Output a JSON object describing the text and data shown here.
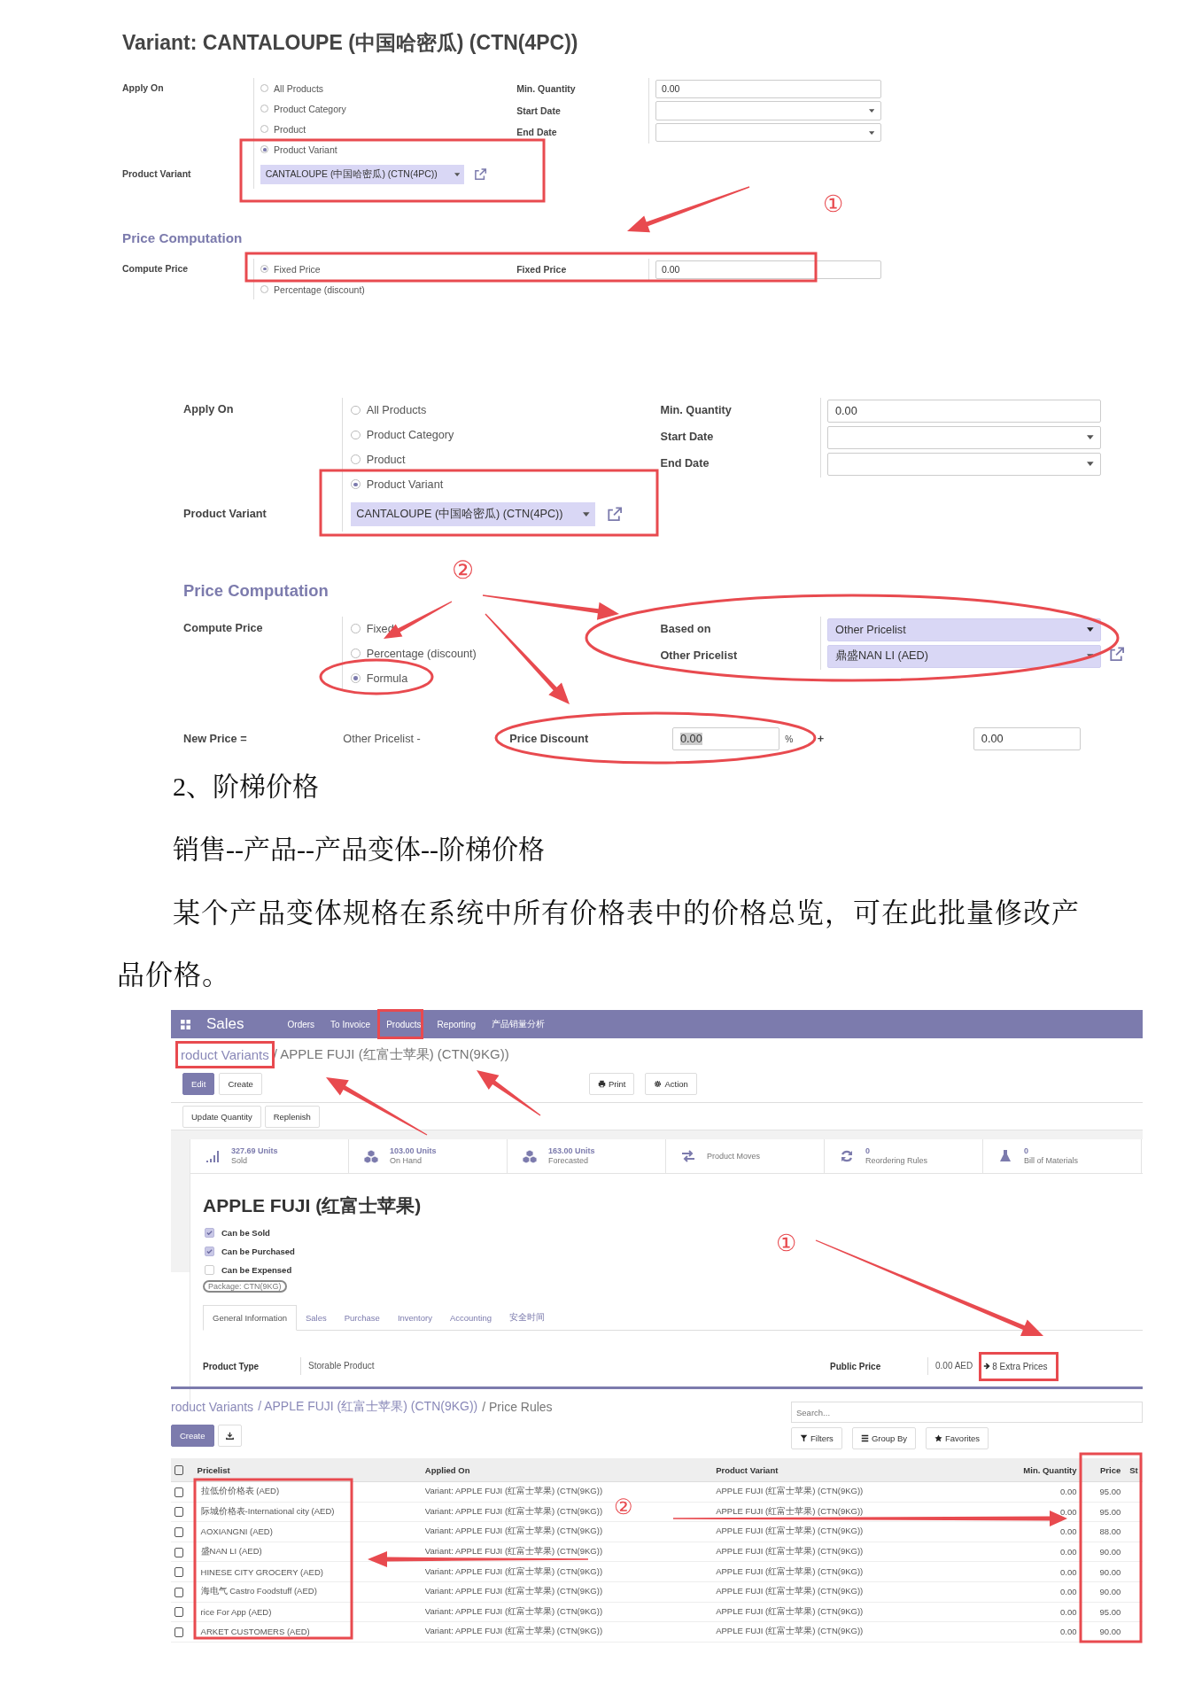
{
  "form1": {
    "title": "Variant: CANTALOUPE (中国哈密瓜) (CTN(4PC))",
    "apply_on_label": "Apply On",
    "apply_on_options": [
      {
        "label": "All Products",
        "selected": false
      },
      {
        "label": "Product Category",
        "selected": false
      },
      {
        "label": "Product",
        "selected": false
      },
      {
        "label": "Product Variant",
        "selected": true
      }
    ],
    "product_variant_label": "Product Variant",
    "product_variant_value": "CANTALOUPE (中国哈密瓜) (CTN(4PC))",
    "min_quantity_label": "Min. Quantity",
    "min_quantity_value": "0.00",
    "start_date_label": "Start Date",
    "end_date_label": "End Date",
    "section_title": "Price Computation",
    "compute_price_label": "Compute Price",
    "compute_options": [
      {
        "label": "Fixed Price",
        "selected": true
      },
      {
        "label": "Percentage (discount)",
        "selected": false
      }
    ],
    "fixed_price_label": "Fixed Price",
    "fixed_price_value": "0.00",
    "callout": "①"
  },
  "form2": {
    "apply_on_label": "Apply On",
    "apply_on_options": [
      {
        "label": "All Products",
        "selected": false
      },
      {
        "label": "Product Category",
        "selected": false
      },
      {
        "label": "Product",
        "selected": false
      },
      {
        "label": "Product Variant",
        "selected": true
      }
    ],
    "product_variant_label": "Product Variant",
    "product_variant_value": "CANTALOUPE (中国哈密瓜) (CTN(4PC))",
    "min_quantity_label": "Min. Quantity",
    "min_quantity_value": "0.00",
    "start_date_label": "Start Date",
    "end_date_label": "End Date",
    "section_title": "Price Computation",
    "compute_price_label": "Compute Price",
    "compute_options": [
      {
        "label": "Fixed",
        "selected": false
      },
      {
        "label": "Percentage (discount)",
        "selected": false
      },
      {
        "label": "Formula",
        "selected": true
      }
    ],
    "based_on_label": "Based on",
    "based_on_value": "Other Pricelist",
    "other_pricelist_label": "Other Pricelist",
    "other_pricelist_value": "鼎盛NAN LI (AED)",
    "new_price_label": "New Price =",
    "formula_prefix": "Other Pricelist -",
    "price_discount_label": "Price Discount",
    "price_discount_value": "0.00",
    "percent_sign": "%",
    "plus_sign": "+",
    "surcharge_value": "0.00",
    "callout": "②"
  },
  "document": {
    "heading": "2、阶梯价格",
    "path": "销售--产品--产品变体--阶梯价格",
    "paragraph": "某个产品变体规格在系统中所有价格表中的价格总览，可在此批量修改产品价格。"
  },
  "product_form": {
    "app_name": "Sales",
    "menu": [
      "Orders",
      "To Invoice",
      "Products",
      "Reporting",
      "产品销量分析"
    ],
    "breadcrumb": [
      {
        "label": "roduct Variants",
        "link": true
      },
      {
        "label": "/ APPLE FUJI (红富士苹果) (CTN(9KG))",
        "link": false
      }
    ],
    "buttons": [
      {
        "label": "Edit",
        "primary": true
      },
      {
        "label": "Create",
        "primary": false
      }
    ],
    "side_buttons": [
      {
        "label": "Print",
        "kind": "print"
      },
      {
        "label": "Action",
        "kind": "gear"
      }
    ],
    "action_buttons": [
      "Update Quantity",
      "Replenish"
    ],
    "stats": [
      {
        "kind": "bars",
        "value": "327.69 Units",
        "label": "Sold"
      },
      {
        "kind": "cubes",
        "value": "103.00 Units",
        "label": "On Hand"
      },
      {
        "kind": "cubes",
        "value": "163.00 Units",
        "label": "Forecasted"
      },
      {
        "kind": "arrows",
        "label": "Product Moves"
      },
      {
        "kind": "refresh",
        "value": "0",
        "label": "Reordering Rules"
      },
      {
        "kind": "flask",
        "value": "0",
        "label": "Bill of Materials"
      }
    ],
    "product_name": "APPLE FUJI (红富士苹果)",
    "checkboxes": [
      {
        "label": "Can be Sold",
        "checked": true
      },
      {
        "label": "Can be Purchased",
        "checked": true
      },
      {
        "label": "Can be Expensed",
        "checked": false
      }
    ],
    "package_tag": "Package: CTN(9KG)",
    "tabs": [
      {
        "label": "General Information",
        "selected": true
      },
      {
        "label": "Sales",
        "selected": false
      },
      {
        "label": "Purchase",
        "selected": false
      },
      {
        "label": "Inventory",
        "selected": false
      },
      {
        "label": "Accounting",
        "selected": false
      },
      {
        "label": "安全时间",
        "selected": false
      }
    ],
    "product_type_label": "Product Type",
    "product_type_value": "Storable Product",
    "public_price_label": "Public Price",
    "public_price_value": "0.00 AED",
    "extra_prices": "8 Extra Prices",
    "callout": "①"
  },
  "price_rules": {
    "breadcrumb": [
      {
        "label": "roduct Variants",
        "link": true
      },
      {
        "label": "/ APPLE FUJI (红富士苹果) (CTN(9KG))",
        "link": true
      },
      {
        "label": "/ Price Rules",
        "link": false
      }
    ],
    "create_button": "Create",
    "search": {
      "placeholder": "Search..."
    },
    "filters": [
      {
        "label": "Filters",
        "kind": "filter"
      },
      {
        "label": "Group By",
        "kind": "list"
      },
      {
        "label": "Favorites",
        "kind": "star"
      }
    ],
    "select_all_checked": false,
    "columns": [
      "Pricelist",
      "Applied On",
      "Product Variant",
      "Min. Quantity",
      "Price",
      "St"
    ],
    "rows": [
      {
        "checked": false,
        "pricelist": "拉低价价格表 (AED)",
        "applied_on": "Variant: APPLE FUJI (红富士苹果) (CTN(9KG))",
        "product_variant": "APPLE FUJI (红富士苹果) (CTN(9KG))",
        "min_quantity": "0.00",
        "price": "95.00"
      },
      {
        "checked": false,
        "pricelist": "际城价格表-International city (AED)",
        "applied_on": "Variant: APPLE FUJI (红富士苹果) (CTN(9KG))",
        "product_variant": "APPLE FUJI (红富士苹果) (CTN(9KG))",
        "min_quantity": "0.00",
        "price": "95.00"
      },
      {
        "checked": false,
        "pricelist": "AOXIANGNI (AED)",
        "applied_on": "Variant: APPLE FUJI (红富士苹果) (CTN(9KG))",
        "product_variant": "APPLE FUJI (红富士苹果) (CTN(9KG))",
        "min_quantity": "0.00",
        "price": "88.00"
      },
      {
        "checked": false,
        "pricelist": "盛NAN LI (AED)",
        "applied_on": "Variant: APPLE FUJI (红富士苹果) (CTN(9KG))",
        "product_variant": "APPLE FUJI (红富士苹果) (CTN(9KG))",
        "min_quantity": "0.00",
        "price": "90.00"
      },
      {
        "checked": false,
        "pricelist": "HINESE CITY GROCERY (AED)",
        "applied_on": "Variant: APPLE FUJI (红富士苹果) (CTN(9KG))",
        "product_variant": "APPLE FUJI (红富士苹果) (CTN(9KG))",
        "min_quantity": "0.00",
        "price": "90.00"
      },
      {
        "checked": false,
        "pricelist": "海电气 Castro Foodstuff (AED)",
        "applied_on": "Variant: APPLE FUJI (红富士苹果) (CTN(9KG))",
        "product_variant": "APPLE FUJI (红富士苹果) (CTN(9KG))",
        "min_quantity": "0.00",
        "price": "90.00"
      },
      {
        "checked": false,
        "pricelist": "rice For App (AED)",
        "applied_on": "Variant: APPLE FUJI (红富士苹果) (CTN(9KG))",
        "product_variant": "APPLE FUJI (红富士苹果) (CTN(9KG))",
        "min_quantity": "0.00",
        "price": "95.00"
      },
      {
        "checked": false,
        "pricelist": "ARKET CUSTOMERS (AED)",
        "applied_on": "Variant: APPLE FUJI (红富士苹果) (CTN(9KG))",
        "product_variant": "APPLE FUJI (红富士苹果) (CTN(9KG))",
        "min_quantity": "0.00",
        "price": "90.00"
      }
    ],
    "callout": "②"
  }
}
